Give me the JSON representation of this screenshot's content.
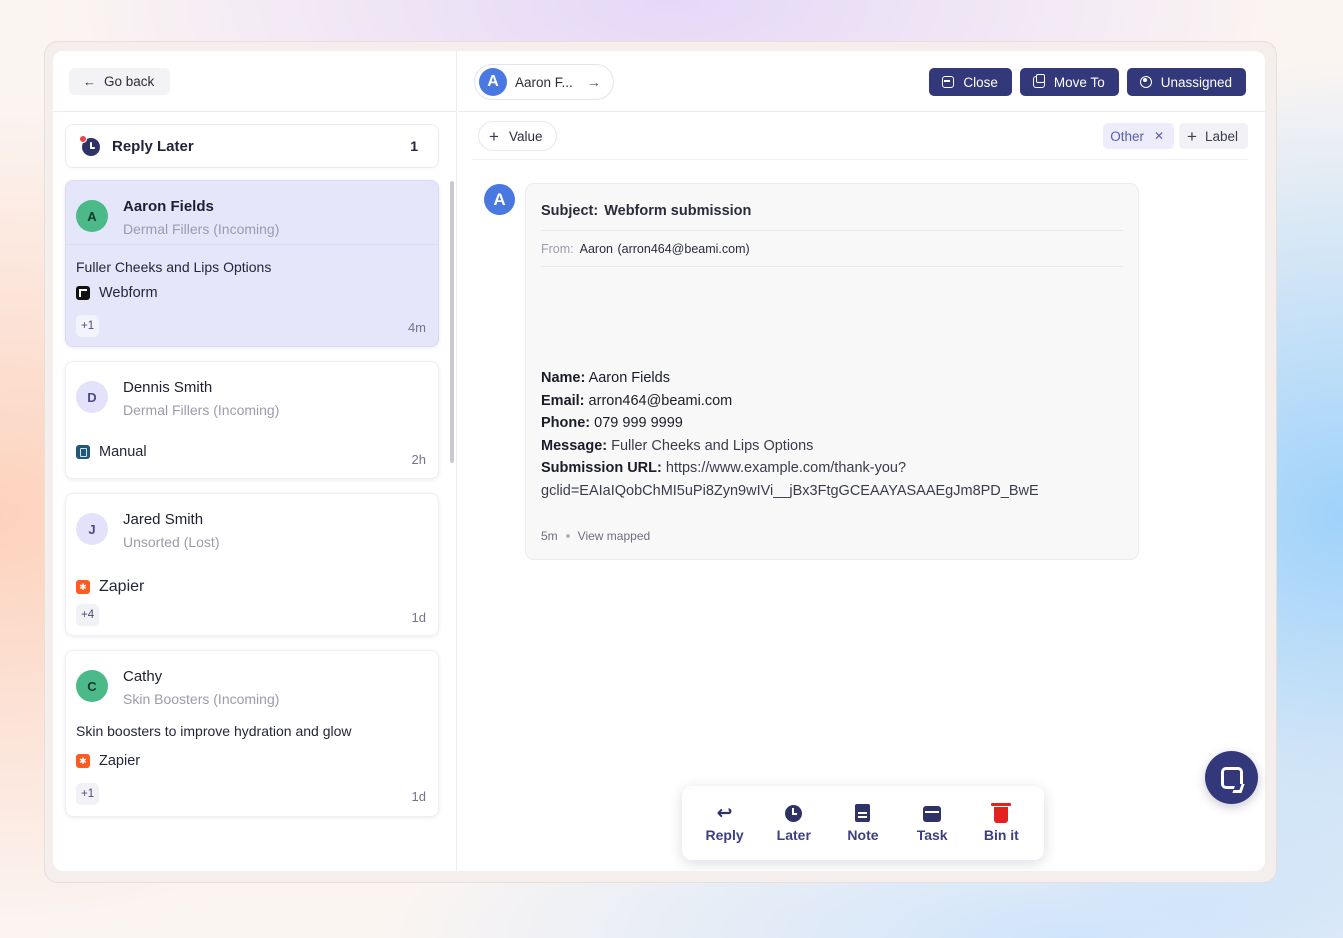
{
  "nav": {
    "go_back": "Go back"
  },
  "folder": {
    "label": "Reply Later",
    "count": "1"
  },
  "conversations": [
    {
      "initial": "A",
      "name": "Aaron Fields",
      "pipeline": "Dermal Fillers (Incoming)",
      "message": "Fuller Cheeks and Lips Options",
      "source": "Webform",
      "badge": "+1",
      "ago": "4m"
    },
    {
      "initial": "D",
      "name": "Dennis Smith",
      "pipeline": "Dermal Fillers (Incoming)",
      "message": "",
      "source": "Manual",
      "badge": "",
      "ago": "2h"
    },
    {
      "initial": "J",
      "name": "Jared Smith",
      "pipeline": "Unsorted (Lost)",
      "message": "",
      "source": "Zapier",
      "badge": "+4",
      "ago": "1d"
    },
    {
      "initial": "C",
      "name": "Cathy",
      "pipeline": "Skin Boosters (Incoming)",
      "message": "Skin boosters to improve hydration and glow",
      "source": "Zapier",
      "badge": "+1",
      "ago": "1d"
    }
  ],
  "header": {
    "contact_initial": "A",
    "contact_name": "Aaron F...",
    "close_label": "Close",
    "move_label": "Move To",
    "assign_label": "Unassigned"
  },
  "fields": {
    "value_label": "Value",
    "tag": "Other",
    "label_button": "Label"
  },
  "email": {
    "avatar_initial": "A",
    "subject_prefix": "Subject:",
    "subject": "Webform submission",
    "from_prefix": "From:",
    "from_name": "Aaron",
    "from_address": "(arron464@beami.com)",
    "name_label": "Name:",
    "name_value": "Aaron Fields",
    "email_label": "Email:",
    "email_value": "arron464@beami.com",
    "phone_label": "Phone:",
    "phone_value": "079 999 9999",
    "message_label": "Message:",
    "message_value": "Fuller Cheeks and Lips Options",
    "url_label": "Submission URL:",
    "url_value_1": "https://www.example.com/thank-you?",
    "url_value_2": "gclid=EAIaIQobChMI5uPi8Zyn9wIVi__jBx3FtgGCEAAYASAAEgJm8PD_BwE",
    "ago": "5m",
    "view_mapped": "View mapped"
  },
  "actions": {
    "reply": "Reply",
    "later": "Later",
    "note": "Note",
    "task": "Task",
    "bin": "Bin it"
  },
  "icons": [
    "arrow-left-icon",
    "clock-icon",
    "webform-icon",
    "manual-icon",
    "zapier-icon",
    "arrow-right-icon",
    "inbox-icon",
    "copy-icon",
    "user-circle-icon",
    "plus-icon",
    "close-icon",
    "reply-icon",
    "note-icon",
    "calendar-icon",
    "trash-icon",
    "chat-icon"
  ],
  "colors": {
    "primary": "#33387a",
    "active_card": "#e6e6fb",
    "avatar_blue": "#4878e0",
    "avatar_green": "#4cb988",
    "bin_red": "#e52020"
  }
}
